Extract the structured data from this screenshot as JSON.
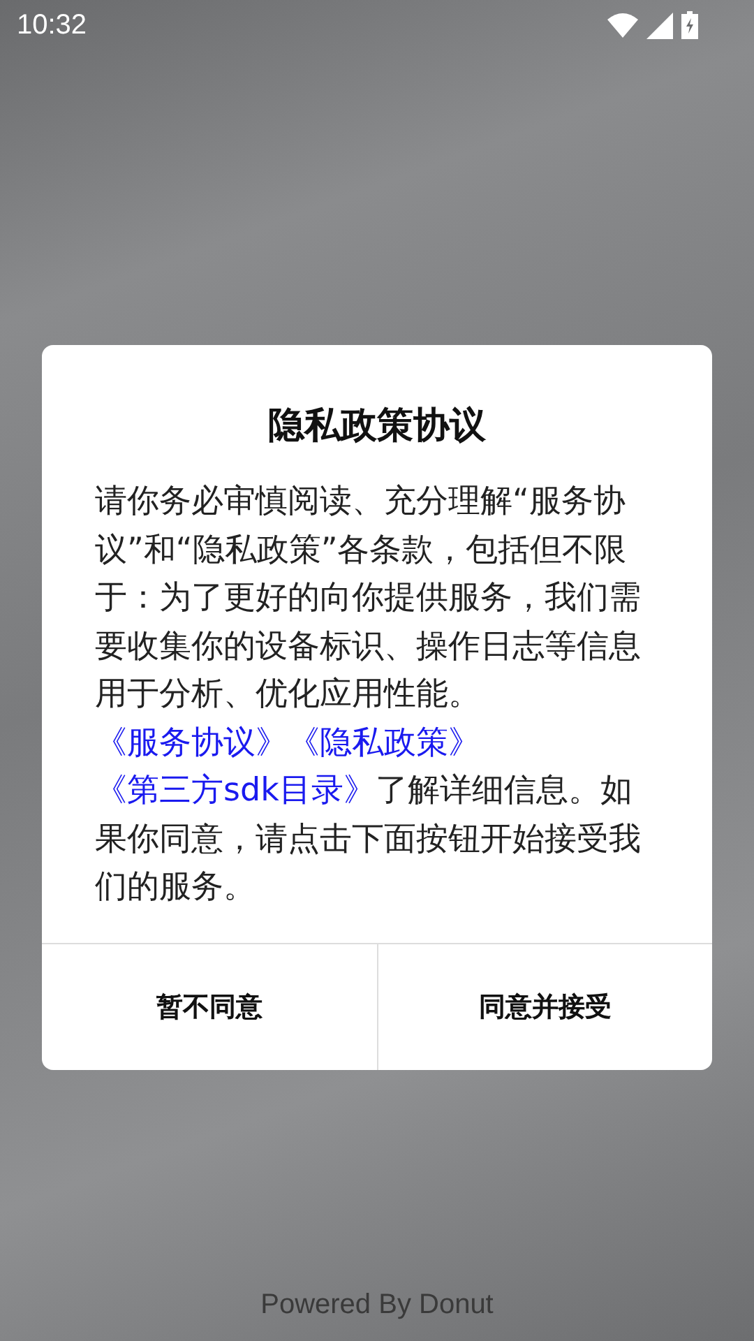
{
  "status_bar": {
    "time": "10:32"
  },
  "dialog": {
    "title": "隐私政策协议",
    "body": [
      {
        "kind": "text",
        "text": "请你务必审慎阅读、充分理解“服务协议”和“隐私政策”各条款，包括但不限于：为了更好的向你提供服务，我们需要收集你的设备标识、操作日志等信息用于分析、优化应用性能。"
      },
      {
        "kind": "link",
        "text": "《服务协议》"
      },
      {
        "kind": "link",
        "text": "《隐私政策》"
      },
      {
        "kind": "link",
        "text": "《第三方sdk目录》"
      },
      {
        "kind": "text",
        "text": "了解详细信息。如果你同意，请点击下面按钮开始接受我们的服务。"
      }
    ],
    "buttons": [
      "暂不同意",
      "同意并接受"
    ]
  },
  "footer": {
    "text": "Powered By Donut"
  }
}
